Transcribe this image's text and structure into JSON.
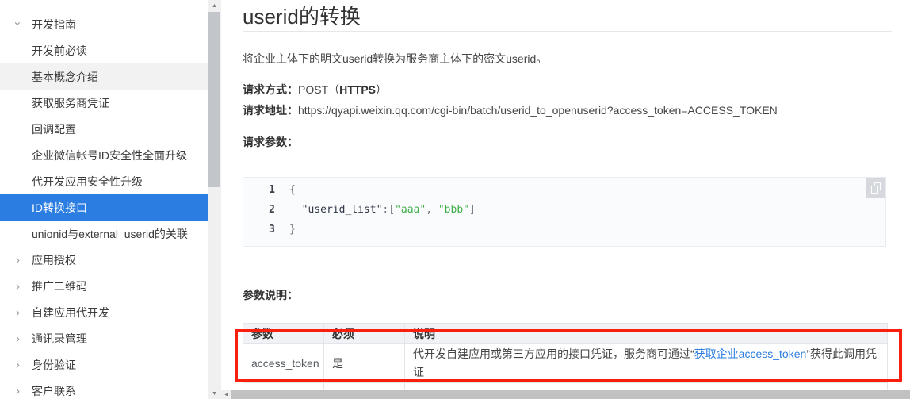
{
  "colors": {
    "accent_blue": "#2b7de1",
    "link_blue": "#2b7de1",
    "annotation_red": "#fa1e0e",
    "code_string_green": "#3fae49",
    "sidebar_hover_gray": "#f2f2f2",
    "table_header_bg": "#f0f2f5"
  },
  "sidebar": {
    "items": [
      {
        "label": "开发指南",
        "type": "group",
        "expanded": true,
        "state": "normal"
      },
      {
        "label": "开发前必读",
        "type": "sub",
        "state": "normal"
      },
      {
        "label": "基本概念介绍",
        "type": "sub",
        "state": "hover"
      },
      {
        "label": "获取服务商凭证",
        "type": "sub",
        "state": "normal"
      },
      {
        "label": "回调配置",
        "type": "sub",
        "state": "normal"
      },
      {
        "label": "企业微信帐号ID安全性全面升级",
        "type": "sub",
        "state": "normal"
      },
      {
        "label": "代开发应用安全性升级",
        "type": "sub",
        "state": "normal"
      },
      {
        "label": "ID转换接口",
        "type": "sub",
        "state": "selected"
      },
      {
        "label": "unionid与external_userid的关联",
        "type": "sub",
        "state": "normal"
      },
      {
        "label": "应用授权",
        "type": "group",
        "expanded": false,
        "state": "normal"
      },
      {
        "label": "推广二维码",
        "type": "group",
        "expanded": false,
        "state": "normal"
      },
      {
        "label": "自建应用代开发",
        "type": "group",
        "expanded": false,
        "state": "normal"
      },
      {
        "label": "通讯录管理",
        "type": "group",
        "expanded": false,
        "state": "normal"
      },
      {
        "label": "身份验证",
        "type": "group",
        "expanded": false,
        "state": "normal"
      },
      {
        "label": "客户联系",
        "type": "group",
        "expanded": false,
        "state": "normal"
      }
    ]
  },
  "content": {
    "title": "userid的转换",
    "intro": "将企业主体下的明文userid转换为服务商主体下的密文userid。",
    "request_method": {
      "label": "请求方式：",
      "pre": "POST（",
      "bold": "HTTPS",
      "post": "）"
    },
    "request_url": {
      "label": "请求地址：",
      "value": "https://qyapi.weixin.qq.com/cgi-bin/batch/userid_to_openuserid?access_token=ACCESS_TOKEN"
    },
    "request_params_label": "请求参数：",
    "params_desc_label": "参数说明：",
    "code": {
      "copy_icon": "copy-icon",
      "lines": [
        {
          "num": "1",
          "tokens": [
            {
              "text": "{",
              "type": "plain"
            }
          ]
        },
        {
          "num": "2",
          "tokens": [
            {
              "text": "  ",
              "type": "plain"
            },
            {
              "text": "\"userid_list\"",
              "type": "key"
            },
            {
              "text": ":[",
              "type": "plain"
            },
            {
              "text": "\"aaa\"",
              "type": "string"
            },
            {
              "text": ", ",
              "type": "plain"
            },
            {
              "text": "\"bbb\"",
              "type": "string"
            },
            {
              "text": "]",
              "type": "plain"
            }
          ]
        },
        {
          "num": "3",
          "tokens": [
            {
              "text": "}",
              "type": "plain"
            }
          ]
        }
      ]
    },
    "table": {
      "headers": [
        "参数",
        "必须",
        "说明"
      ],
      "rows": [
        {
          "param": "access_token",
          "required": "是",
          "desc_pre": "代开发自建应用或第三方应用的接口凭证，服务商可通过“",
          "link": "获取企业access_token",
          "desc_post": "”获得此调用凭证"
        }
      ]
    }
  }
}
